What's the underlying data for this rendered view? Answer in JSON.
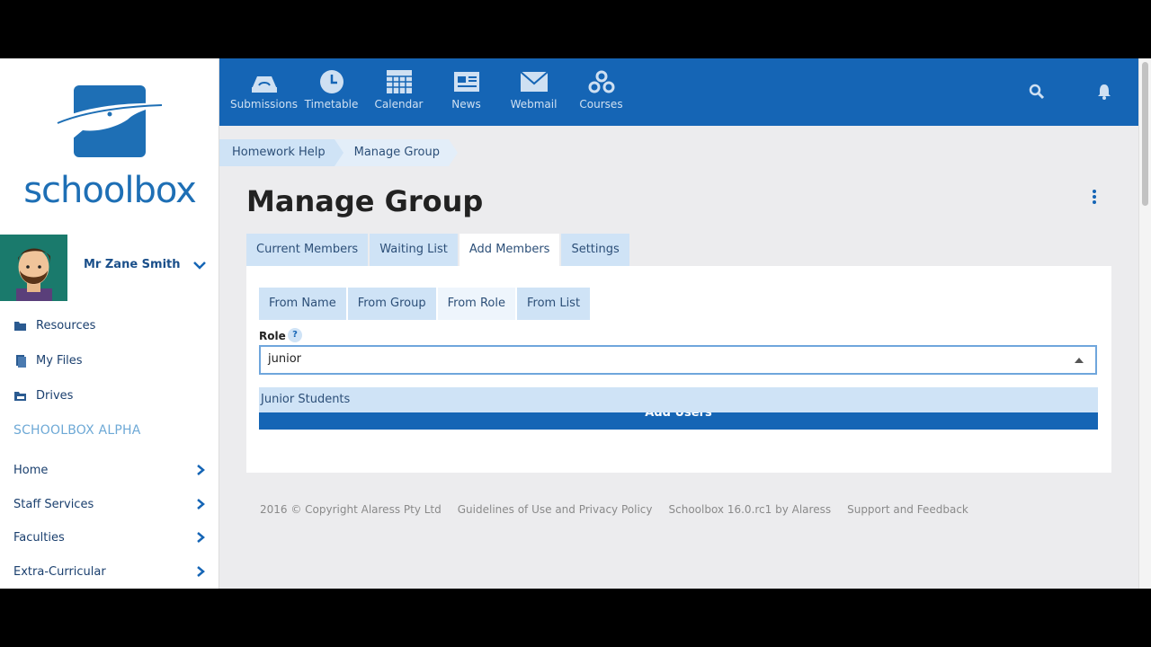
{
  "brand": {
    "name": "schoolbox"
  },
  "user": {
    "name": "Mr Zane Smith"
  },
  "sidebar": {
    "links": [
      {
        "label": "Resources",
        "icon": "folder-open-icon"
      },
      {
        "label": "My Files",
        "icon": "files-icon"
      },
      {
        "label": "Drives",
        "icon": "drive-folder-icon"
      }
    ],
    "section_title": "SCHOOLBOX ALPHA",
    "nav": [
      {
        "label": "Home"
      },
      {
        "label": "Staff Services"
      },
      {
        "label": "Faculties"
      },
      {
        "label": "Extra-Curricular"
      }
    ]
  },
  "topnav": [
    {
      "label": "Submissions",
      "icon": "submissions-icon"
    },
    {
      "label": "Timetable",
      "icon": "clock-icon"
    },
    {
      "label": "Calendar",
      "icon": "calendar-icon"
    },
    {
      "label": "News",
      "icon": "news-icon"
    },
    {
      "label": "Webmail",
      "icon": "mail-icon"
    },
    {
      "label": "Courses",
      "icon": "courses-icon"
    }
  ],
  "breadcrumb": [
    "Homework Help",
    "Manage Group"
  ],
  "page": {
    "title": "Manage Group"
  },
  "tabs": [
    "Current Members",
    "Waiting List",
    "Add Members",
    "Settings"
  ],
  "active_tab": "Add Members",
  "subtabs": [
    "From Name",
    "From Group",
    "From Role",
    "From List"
  ],
  "active_subtab": "From Role",
  "form": {
    "role_label": "Role",
    "help": "?",
    "role_value": "junior",
    "dropdown_option": "Junior Students",
    "add_button": "Add Users"
  },
  "footer": [
    "2016 © Copyright Alaress Pty Ltd",
    "Guidelines of Use and Privacy Policy",
    "Schoolbox 16.0.rc1 by Alaress",
    "Support and Feedback"
  ],
  "colors": {
    "brand_blue": "#1565b5",
    "tab_bg": "#cfe3f6",
    "page_bg": "#ececee"
  }
}
